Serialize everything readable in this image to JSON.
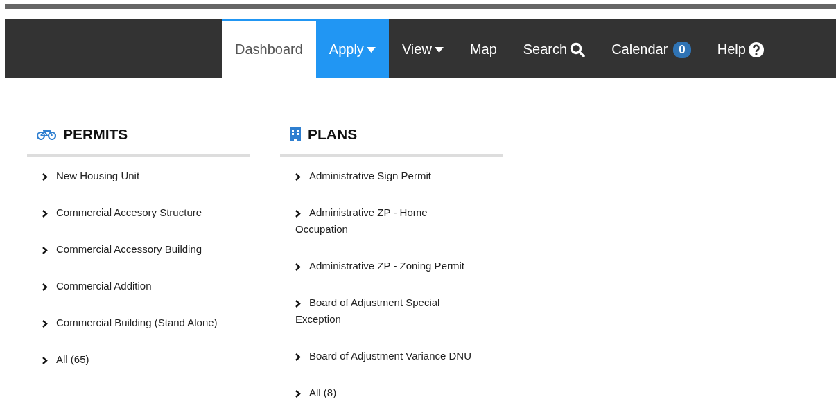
{
  "nav": [
    {
      "label": "Dashboard",
      "kind": "plain",
      "selected": true,
      "expanded": false
    },
    {
      "label": "Apply",
      "kind": "dropdown",
      "selected": false,
      "expanded": true
    },
    {
      "label": "View",
      "kind": "dropdown",
      "selected": false,
      "expanded": false
    },
    {
      "label": "Map",
      "kind": "plain",
      "selected": false,
      "expanded": false
    },
    {
      "label": "Search",
      "kind": "search",
      "selected": false,
      "expanded": false
    },
    {
      "label": "Calendar",
      "kind": "badge",
      "badge": "0",
      "selected": false,
      "expanded": false
    },
    {
      "label": "Help",
      "kind": "help",
      "selected": false,
      "expanded": false
    }
  ],
  "sections": [
    {
      "title": "PERMITS",
      "kind": "bicycle",
      "items": [
        "New Housing Unit",
        "Commercial Accesory Structure",
        "Commercial Accessory Building",
        "Commercial Addition",
        "Commercial Building (Stand Alone)",
        "All (65)"
      ]
    },
    {
      "title": "PLANS",
      "kind": "building",
      "items": [
        "Administrative Sign Permit",
        "Administrative ZP - Home Occupation",
        "Administrative ZP - Zoning Permit",
        "Board of Adjustment Special Exception",
        "Board of Adjustment Variance DNU",
        "All (8)"
      ]
    }
  ]
}
